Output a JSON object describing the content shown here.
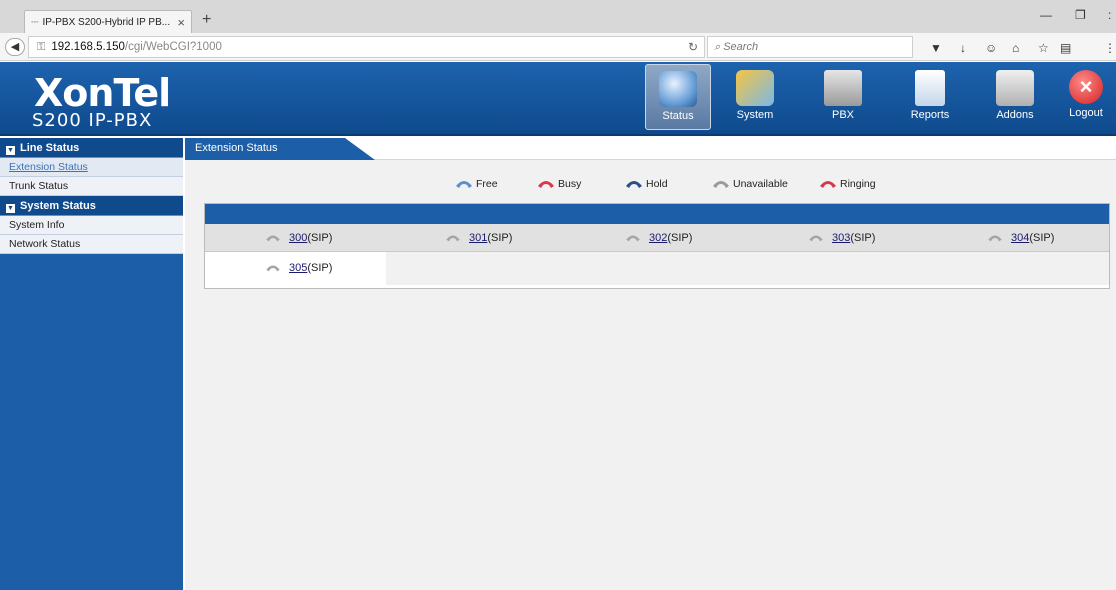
{
  "browser": {
    "tab_title": "IP-PBX S200-Hybrid IP PB...",
    "url_host": "192.168.5.150",
    "url_path": "/cgi/WebCGI?1000",
    "search_placeholder": "Search"
  },
  "header": {
    "logo_main": "XonTel",
    "logo_sub": "S200 IP-PBX",
    "nav": [
      {
        "label": "Status",
        "icon": "status-icon",
        "active": true
      },
      {
        "label": "System",
        "icon": "system-icon"
      },
      {
        "label": "PBX",
        "icon": "pbx-icon"
      },
      {
        "label": "Reports",
        "icon": "reports-icon"
      },
      {
        "label": "Addons",
        "icon": "addons-icon"
      },
      {
        "label": "Logout",
        "icon": "logout-icon"
      }
    ]
  },
  "sidebar": {
    "sections": [
      {
        "title": "Line Status",
        "items": [
          "Extension Status",
          "Trunk Status"
        ]
      },
      {
        "title": "System Status",
        "items": [
          "System Info",
          "Network Status"
        ]
      }
    ]
  },
  "content": {
    "tab": "Extension Status",
    "legend": [
      {
        "label": "Free",
        "color": "#5a8fd0"
      },
      {
        "label": "Busy",
        "color": "#d63a4a"
      },
      {
        "label": "Hold",
        "color": "#2a4f86"
      },
      {
        "label": "Unavailable",
        "color": "#9a9a9a"
      },
      {
        "label": "Ringing",
        "color": "#d63a4a"
      }
    ],
    "extensions": [
      {
        "number": "300",
        "type": "(SIP)"
      },
      {
        "number": "301",
        "type": "(SIP)"
      },
      {
        "number": "302",
        "type": "(SIP)"
      },
      {
        "number": "303",
        "type": "(SIP)"
      },
      {
        "number": "304",
        "type": "(SIP)"
      },
      {
        "number": "305",
        "type": "(SIP)"
      }
    ]
  },
  "colors": {
    "brand": "#1c5ea8",
    "header": "#0f4a8d"
  }
}
